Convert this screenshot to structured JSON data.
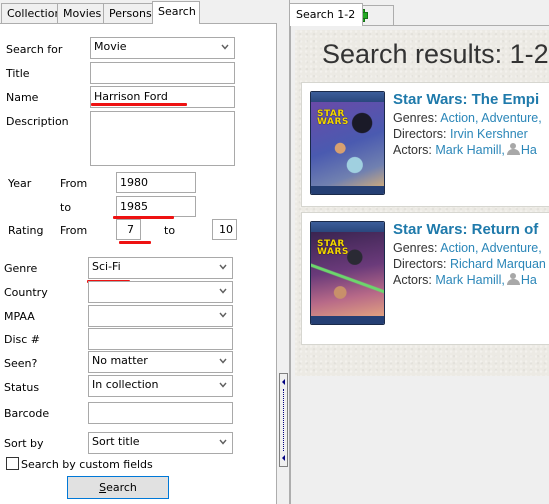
{
  "left_tabs": [
    {
      "label": "Collection",
      "active": false
    },
    {
      "label": "Movies",
      "active": false
    },
    {
      "label": "Persons",
      "active": false
    },
    {
      "label": "Search",
      "active": true
    }
  ],
  "search_form": {
    "search_for": {
      "label": "Search for",
      "value": "Movie"
    },
    "title": {
      "label": "Title",
      "value": ""
    },
    "name": {
      "label": "Name",
      "value": "Harrison Ford"
    },
    "description": {
      "label": "Description",
      "value": ""
    },
    "year": {
      "label": "Year",
      "from_label": "From",
      "to_label": "to",
      "from": "1980",
      "to": "1985"
    },
    "rating": {
      "label": "Rating",
      "from_label": "From",
      "to_label": "to",
      "from": "7",
      "to": "10"
    },
    "genre": {
      "label": "Genre",
      "value": "Sci-Fi"
    },
    "country": {
      "label": "Country",
      "value": ""
    },
    "mpaa": {
      "label": "MPAA",
      "value": ""
    },
    "disc": {
      "label": "Disc #",
      "value": ""
    },
    "seen": {
      "label": "Seen?",
      "value": "No matter"
    },
    "status": {
      "label": "Status",
      "value": "In collection"
    },
    "barcode": {
      "label": "Barcode",
      "value": ""
    },
    "sort_by": {
      "label": "Sort by",
      "value": "Sort title"
    },
    "custom_fields": {
      "label": "Search by custom fields",
      "checked": false
    },
    "search_button": {
      "label_underlined": "S",
      "label_rest": "earch"
    }
  },
  "highlight_color": "#ee1111",
  "right_tabs": [
    {
      "label": "Search 1-2",
      "active": true
    }
  ],
  "add_tab_icon": "plus-icon",
  "results": {
    "title": "Search results: 1-2",
    "items": [
      {
        "title": "Star Wars: The Empire Strikes Back",
        "title_visible": "Star Wars: The Empi",
        "cover_logo": "STAR WARS",
        "genres_label": "Genres:",
        "genres": "Action, Adventure,",
        "directors_label": "Directors:",
        "directors": "Irvin Kershner",
        "actors_label": "Actors:",
        "actor_1": "Mark Hamill,",
        "actor_2_visible": "Ha"
      },
      {
        "title": "Star Wars: Return of the Jedi",
        "title_visible": "Star Wars: Return of",
        "cover_logo": "STAR WARS",
        "genres_label": "Genres:",
        "genres": "Action, Adventure,",
        "directors_label": "Directors:",
        "directors": "Richard Marquan",
        "actors_label": "Actors:",
        "actor_1": "Mark Hamill,",
        "actor_2_visible": "Ha"
      }
    ]
  },
  "colors": {
    "link": "#2a86b8",
    "result_title": "#1f7aab",
    "button_border": "#0078d7"
  }
}
